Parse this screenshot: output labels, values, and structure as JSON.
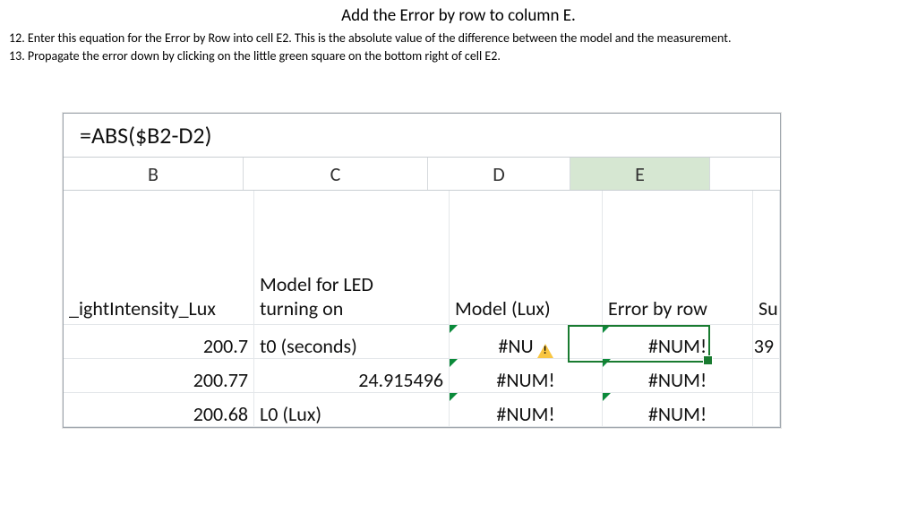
{
  "title": "Add the Error by row to column E.",
  "steps": {
    "s12": "12. Enter this equation for the Error by Row into cell E2.  This is the absolute value of the difference between the model and the measurement.",
    "s13": "13. Propagate the error down by clicking on the little green square on the bottom right of cell E2."
  },
  "formula_bar": "=ABS($B2-D2)",
  "columns": {
    "B": "B",
    "C": "C",
    "D": "D",
    "E": "E"
  },
  "headers": {
    "B": "_ightIntensity_Lux",
    "C_line1": "Model for LED",
    "C_line2": "turning on",
    "D": "Model (Lux)",
    "E": "Error by row",
    "F": "Sum"
  },
  "rows": [
    {
      "B": "200.7",
      "C": "t0 (seconds)",
      "D": "#NU",
      "D_warn": true,
      "E": "#NUM!",
      "F": "39"
    },
    {
      "B": "200.77",
      "C": "24.915496",
      "D": "#NUM!",
      "D_warn": false,
      "E": "#NUM!",
      "F": ""
    },
    {
      "B": "200.68",
      "C": "L0 (Lux)",
      "D": "#NUM!",
      "D_warn": false,
      "E": "#NUM!",
      "F": ""
    }
  ]
}
